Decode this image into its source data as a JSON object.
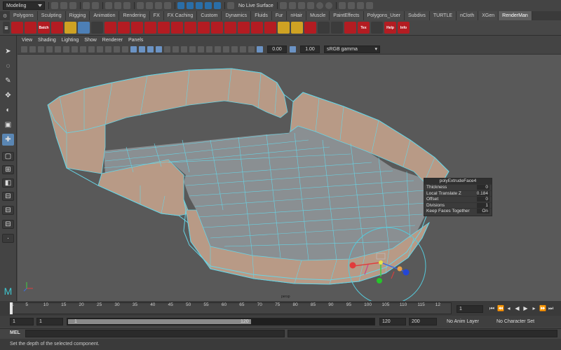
{
  "status_line": {
    "mode": "Modeling",
    "live_surface": "No Live Surface"
  },
  "shelf": {
    "tabs": [
      "Polygons",
      "Sculpting",
      "Rigging",
      "Animation",
      "Rendering",
      "FX",
      "FX Caching",
      "Custom",
      "Dynamics",
      "Fluids",
      "Fur",
      "nHair",
      "Muscle",
      "PaintEffects",
      "Polygons_User",
      "Subdivs",
      "TURTLE",
      "nCloth",
      "XGen",
      "RenderMan"
    ],
    "active_tab": "RenderMan",
    "icons": [
      {
        "name": "render-settings-icon",
        "label": "",
        "color": "#b31c22"
      },
      {
        "name": "render-icon",
        "label": "",
        "color": "#b31c22"
      },
      {
        "name": "batch-render-icon",
        "label": "Batch",
        "color": "#b31c22"
      },
      {
        "name": "ipr-icon",
        "label": "",
        "color": "#b31c22"
      },
      {
        "name": "light-icon",
        "label": "",
        "color": "#cfa223"
      },
      {
        "name": "env-light-icon",
        "label": "",
        "color": "#4d7fb6"
      },
      {
        "name": "sphere-icon",
        "label": "",
        "color": "#3b3b3b"
      },
      {
        "name": "material-icon",
        "label": "",
        "color": "#b31c22"
      },
      {
        "name": "shader-icon",
        "label": "",
        "color": "#b31c22"
      },
      {
        "name": "texture-icon",
        "label": "",
        "color": "#b31c22"
      },
      {
        "name": "light-filter-icon",
        "label": "",
        "color": "#b31c22"
      },
      {
        "name": "portal-icon",
        "label": "",
        "color": "#b31c22"
      },
      {
        "name": "dome-icon",
        "label": "",
        "color": "#b31c22"
      },
      {
        "name": "flag-icon",
        "label": "",
        "color": "#b31c22"
      },
      {
        "name": "hair-icon",
        "label": "",
        "color": "#b31c22"
      },
      {
        "name": "volume-icon",
        "label": "",
        "color": "#b31c22"
      },
      {
        "name": "archive-icon",
        "label": "",
        "color": "#b31c22"
      },
      {
        "name": "instance-icon",
        "label": "",
        "color": "#b31c22"
      },
      {
        "name": "bake-icon",
        "label": "",
        "color": "#b31c22"
      },
      {
        "name": "aov-icon",
        "label": "",
        "color": "#b31c22"
      },
      {
        "name": "star-icon",
        "label": "",
        "color": "#cfa223"
      },
      {
        "name": "bulb-icon",
        "label": "",
        "color": "#cfa223"
      },
      {
        "name": "camera-icon",
        "label": "",
        "color": "#b31c22"
      },
      {
        "name": "gizmo-icon",
        "label": "",
        "color": "#3b3b3b"
      },
      {
        "name": "cross-icon",
        "label": "",
        "color": "#3b3b3b"
      },
      {
        "name": "scene-icon",
        "label": "",
        "color": "#b31c22"
      },
      {
        "name": "tex-icon",
        "label": "Tex",
        "color": "#b31c22"
      },
      {
        "name": "mesh-icon",
        "label": "",
        "color": "#3b3b3b"
      },
      {
        "name": "help-icon",
        "label": "Help",
        "color": "#b31c22"
      },
      {
        "name": "info-icon",
        "label": "Info",
        "color": "#b31c22"
      }
    ]
  },
  "panel": {
    "menus": [
      "View",
      "Shading",
      "Lighting",
      "Show",
      "Renderer",
      "Panels"
    ],
    "gamma_value": "0.00",
    "exposure_value": "1.00",
    "color_space": "sRGB gamma",
    "camera_label": "persp"
  },
  "inview_editor": {
    "title": "polyExtrudeFace4",
    "rows": [
      {
        "label": "Thickness",
        "value": "0"
      },
      {
        "label": "Local Translate Z",
        "value": "0.184"
      },
      {
        "label": "Offset",
        "value": "0"
      },
      {
        "label": "Divisions",
        "value": "1"
      },
      {
        "label": "Keep Faces Together",
        "value": "On"
      }
    ]
  },
  "time_slider": {
    "ticks": [
      "1",
      "5",
      "10",
      "15",
      "20",
      "25",
      "30",
      "35",
      "40",
      "45",
      "50",
      "55",
      "60",
      "65",
      "70",
      "75",
      "80",
      "85",
      "90",
      "95",
      "100",
      "105",
      "110",
      "115",
      "12"
    ],
    "current_frame": "1"
  },
  "range_slider": {
    "start_time": "1",
    "playback_start": "1",
    "range_start_label": "1",
    "range_end_label": "120",
    "playback_end": "120",
    "end_time": "200",
    "anim_layer": "No Anim Layer",
    "character_set": "No Character Set"
  },
  "command_line": {
    "label": "MEL"
  },
  "help_line": {
    "text": "Set the depth of the selected component."
  },
  "colors": {
    "wire": "#67d5e6",
    "face": "#8a8f92",
    "wall": "#b89a86",
    "selected_tab": "#5f5f5f"
  }
}
